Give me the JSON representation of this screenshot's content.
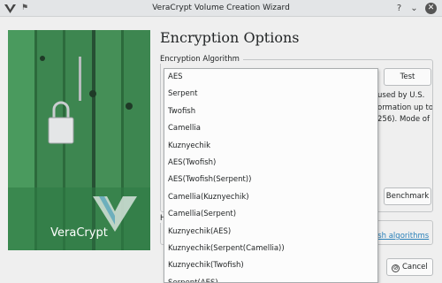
{
  "window": {
    "title": "VeraCrypt Volume Creation Wizard"
  },
  "banner": {
    "brand": "VeraCrypt"
  },
  "page": {
    "title": "Encryption Options"
  },
  "encryption": {
    "group_label": "Encryption Algorithm",
    "test_label": "Test",
    "description_lines": [
      "used by U.S.",
      "ormation up to",
      "256). Mode of"
    ],
    "benchmark_label": "Benchmark",
    "algorithms": [
      "AES",
      "Serpent",
      "Twofish",
      "Camellia",
      "Kuznyechik",
      "AES(Twofish)",
      "AES(Twofish(Serpent))",
      "Camellia(Kuznyechik)",
      "Camellia(Serpent)",
      "Kuznyechik(AES)",
      "Kuznyechik(Serpent(Camellia))",
      "Kuznyechik(Twofish)",
      "Serpent(AES)"
    ]
  },
  "hash": {
    "group_label_fragment": "H",
    "link_label": "ash algorithms"
  },
  "footer": {
    "cancel_label": "Cancel"
  },
  "colors": {
    "banner_green": "#3f8a52",
    "link_blue": "#2980b9"
  }
}
